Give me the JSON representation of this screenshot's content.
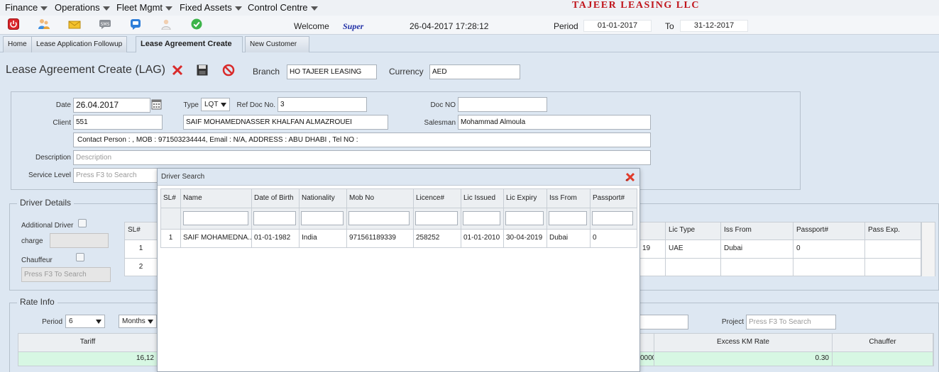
{
  "menu": {
    "items": [
      {
        "label": "Finance"
      },
      {
        "label": "Operations"
      },
      {
        "label": "Fleet Mgmt"
      },
      {
        "label": "Fixed Assets"
      },
      {
        "label": "Control Centre"
      }
    ],
    "company": "TAJEER LEASING LLC"
  },
  "toolbar": {
    "icons": [
      "power-icon",
      "users-icon",
      "mail-icon",
      "sms-icon",
      "chat-icon",
      "user-help-icon",
      "check-icon"
    ],
    "sms_text": "SMS",
    "welcome_label": "Welcome",
    "user": "Super",
    "datetime": "26-04-2017 17:28:12",
    "period_label": "Period",
    "period_from": "01-01-2017",
    "to_label": "To",
    "period_to": "31-12-2017"
  },
  "tabs": [
    {
      "label": "Home",
      "active": false
    },
    {
      "label": "Lease Application Followup",
      "active": false
    },
    {
      "label": "Lease Agreement Create",
      "active": true
    },
    {
      "label": "New Customer",
      "active": false
    }
  ],
  "page": {
    "title": "Lease Agreement Create (LAG)",
    "branch_label": "Branch",
    "branch_value": "HO TAJEER LEASING",
    "currency_label": "Currency",
    "currency_value": "AED"
  },
  "form": {
    "date_label": "Date",
    "date_value": "26.04.2017",
    "type_label": "Type",
    "type_value": "LQT",
    "refdoc_label": "Ref Doc No.",
    "refdoc_value": "3",
    "docno_label": "Doc NO",
    "docno_value": "",
    "client_label": "Client",
    "client_code": "551",
    "client_name": "SAIF MOHAMEDNASSER KHALFAN ALMAZROUEI",
    "salesman_label": "Salesman",
    "salesman_value": "Mohammad Almoula",
    "contact_info": "Contact Person : , MOB : 971503234444, Email : N/A, ADDRESS : ABU DHABI , Tel NO :",
    "description_label": "Description",
    "description_placeholder": "Description",
    "service_label": "Service Level",
    "service_placeholder": "Press F3 to Search"
  },
  "driver_details": {
    "legend": "Driver Details",
    "additional_driver_label": "Additional Driver",
    "charge_label": "charge",
    "chauffeur_label": "Chauffeur",
    "chauffeur_placeholder": "Press F3 To Search",
    "grid_headers_left": [
      "SL#"
    ],
    "grid_headers_right": [
      "Lic Type",
      "Iss From",
      "Passport#",
      "Pass Exp."
    ],
    "rows": [
      {
        "sl": "1",
        "partial": "19",
        "lic_type": "UAE",
        "iss_from": "Dubai",
        "passport": "0",
        "pass_exp": ""
      },
      {
        "sl": "2",
        "partial": "",
        "lic_type": "",
        "iss_from": "",
        "passport": "",
        "pass_exp": ""
      }
    ]
  },
  "rate_info": {
    "legend": "Rate Info",
    "period_label": "Period",
    "period_value": "6",
    "unit_value": "Months",
    "project_label": "Project",
    "project_placeholder": "Press F3 To Search",
    "headers": {
      "tariff": "Tariff",
      "excess_km": "Excess KM Rate",
      "chauffer": "Chauffer"
    },
    "values": {
      "tariff_partial": "16,12",
      "partial_mid": "0000",
      "excess_km": "0.30"
    }
  },
  "driver_search": {
    "title": "Driver Search",
    "headers": [
      "SL#",
      "Name",
      "Date of Birth",
      "Nationality",
      "Mob No",
      "Licence#",
      "Lic Issued",
      "Lic Expiry",
      "Iss From",
      "Passport#"
    ],
    "rows": [
      [
        "1",
        "SAIF MOHAMEDNA...",
        "01-01-1982",
        "India",
        "971561189339",
        "258252",
        "01-01-2010",
        "30-04-2019",
        "Dubai",
        "0"
      ]
    ]
  },
  "colors": {
    "background": "#dde7f2",
    "company_red": "#c0141b",
    "rate_row_green": "#d7f7e3"
  }
}
